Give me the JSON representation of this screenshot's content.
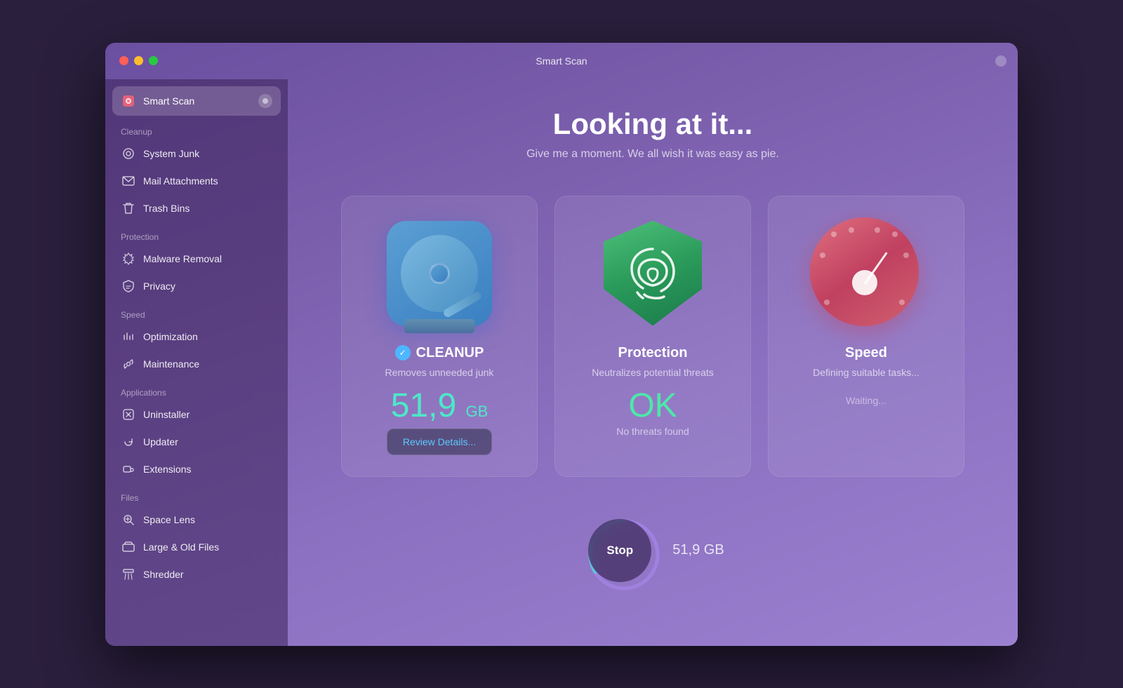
{
  "window": {
    "title": "Smart Scan"
  },
  "sidebar": {
    "active_item": "Smart Scan",
    "items_top": [
      {
        "id": "smart-scan",
        "label": "Smart Scan",
        "icon": "⊙",
        "active": true
      }
    ],
    "sections": [
      {
        "label": "Cleanup",
        "items": [
          {
            "id": "system-junk",
            "label": "System Junk",
            "icon": "⚙"
          },
          {
            "id": "mail-attachments",
            "label": "Mail Attachments",
            "icon": "✉"
          },
          {
            "id": "trash-bins",
            "label": "Trash Bins",
            "icon": "🗑"
          }
        ]
      },
      {
        "label": "Protection",
        "items": [
          {
            "id": "malware-removal",
            "label": "Malware Removal",
            "icon": "☣"
          },
          {
            "id": "privacy",
            "label": "Privacy",
            "icon": "✋"
          }
        ]
      },
      {
        "label": "Speed",
        "items": [
          {
            "id": "optimization",
            "label": "Optimization",
            "icon": "⧖"
          },
          {
            "id": "maintenance",
            "label": "Maintenance",
            "icon": "🔧"
          }
        ]
      },
      {
        "label": "Applications",
        "items": [
          {
            "id": "uninstaller",
            "label": "Uninstaller",
            "icon": "⊠"
          },
          {
            "id": "updater",
            "label": "Updater",
            "icon": "↻"
          },
          {
            "id": "extensions",
            "label": "Extensions",
            "icon": "⇥"
          }
        ]
      },
      {
        "label": "Files",
        "items": [
          {
            "id": "space-lens",
            "label": "Space Lens",
            "icon": "◎"
          },
          {
            "id": "large-old-files",
            "label": "Large & Old Files",
            "icon": "▭"
          },
          {
            "id": "shredder",
            "label": "Shredder",
            "icon": "≡"
          }
        ]
      }
    ]
  },
  "main": {
    "title": "Looking at it...",
    "subtitle": "Give me a moment. We all wish it was easy as pie.",
    "cards": [
      {
        "id": "cleanup",
        "title": "CLEANUP",
        "has_check": true,
        "subtitle": "Removes unneeded junk",
        "stat": "51,9",
        "stat_unit": "GB",
        "stat_color": "teal",
        "action_label": "Review Details..."
      },
      {
        "id": "protection",
        "title": "Protection",
        "has_check": false,
        "subtitle": "Neutralizes potential threats",
        "stat": "OK",
        "stat_color": "green",
        "sub_label": "No threats found"
      },
      {
        "id": "speed",
        "title": "Speed",
        "has_check": false,
        "subtitle": "Defining suitable tasks...",
        "waiting_label": "Waiting..."
      }
    ],
    "stop_button_label": "Stop",
    "stop_size": "51,9 GB"
  }
}
